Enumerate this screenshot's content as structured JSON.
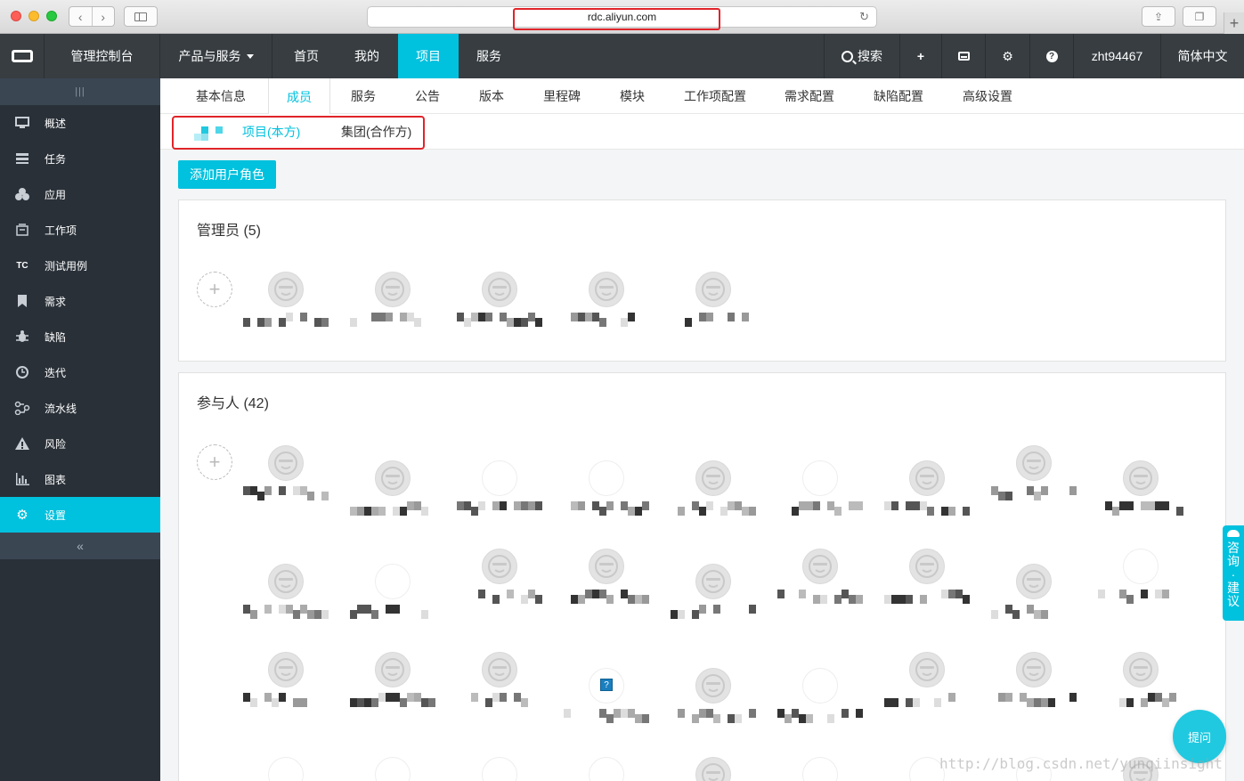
{
  "browser": {
    "url": "rdc.aliyun.com",
    "back_icon": "chevron-left-icon",
    "forward_icon": "chevron-right-icon"
  },
  "topnav": {
    "console": "管理控制台",
    "products": "产品与服务",
    "home": "首页",
    "mine": "我的",
    "project": "项目",
    "service": "服务",
    "search": "搜索",
    "plus": "+",
    "user": "zht94467",
    "lang": "简体中文"
  },
  "sidebar": {
    "items": [
      {
        "label": "概述",
        "icon": "monitor-icon"
      },
      {
        "label": "任务",
        "icon": "list-icon"
      },
      {
        "label": "应用",
        "icon": "cubes-icon"
      },
      {
        "label": "工作项",
        "icon": "inbox-icon"
      },
      {
        "label": "测试用例",
        "icon": "tc-icon"
      },
      {
        "label": "需求",
        "icon": "bookmark-icon"
      },
      {
        "label": "缺陷",
        "icon": "bug-icon"
      },
      {
        "label": "迭代",
        "icon": "clock-icon"
      },
      {
        "label": "流水线",
        "icon": "pipeline-icon"
      },
      {
        "label": "风险",
        "icon": "warning-icon"
      },
      {
        "label": "图表",
        "icon": "chart-icon"
      },
      {
        "label": "设置",
        "icon": "gear-icon"
      }
    ],
    "active": "设置"
  },
  "subtabs": [
    "基本信息",
    "成员",
    "服务",
    "公告",
    "版本",
    "里程碑",
    "模块",
    "工作项配置",
    "需求配置",
    "缺陷配置",
    "高级设置"
  ],
  "subtabs_active": "成员",
  "roletabs": [
    "项目(本方)",
    "集团(合作方)"
  ],
  "add_role_label": "添加用户角色",
  "admins": {
    "title": "管理员 (5)"
  },
  "participants": {
    "title": "参与人 (42)"
  },
  "consult": [
    "咨",
    "询",
    "·",
    "建",
    "议"
  ],
  "ask_label": "提问",
  "watermark": "http://blog.csdn.net/yunqiinsight",
  "colors": {
    "accent": "#00c1de",
    "nav_bg": "#373d41",
    "sidebar_bg": "#293038",
    "highlight": "#e0242a"
  }
}
